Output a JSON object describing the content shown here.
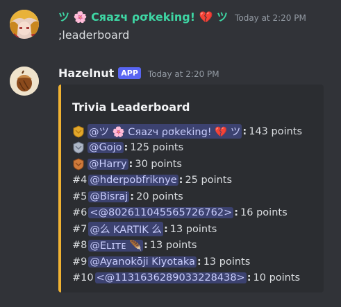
{
  "message1": {
    "author": "ツ 🌸 Cяazч ρσkeking! 💔 ツ",
    "timestamp": "Today at 2:20 PM",
    "content": ";leaderboard",
    "author_color": "#3ed6a4"
  },
  "message2": {
    "author": "Hazelnut",
    "badge": "APP",
    "timestamp": "Today at 2:20 PM"
  },
  "embed": {
    "accent_color": "#f0b232",
    "title": "Trivia Leaderboard",
    "rows": [
      {
        "rank": "",
        "medal": "gold-medal-icon",
        "user": "@ツ 🌸 Cяazч ρσkeking! 💔 ツ",
        "score": "143 points"
      },
      {
        "rank": "",
        "medal": "silver-medal-icon",
        "user": "@Gojo",
        "score": "125 points"
      },
      {
        "rank": "",
        "medal": "bronze-medal-icon",
        "user": "@Harry",
        "score": "30 points"
      },
      {
        "rank": "#4",
        "medal": "",
        "user": "@hderpobfriknye",
        "score": "25 points"
      },
      {
        "rank": "#5",
        "medal": "",
        "user": "@Bisraj",
        "score": "20 points"
      },
      {
        "rank": "#6",
        "medal": "",
        "user": "<@802611045565726762>",
        "score": "16 points"
      },
      {
        "rank": "#7",
        "medal": "",
        "user": "@么 KARTIK 么",
        "score": "13 points"
      },
      {
        "rank": "#8",
        "medal": "",
        "user": "@Eʟɪᴛᴇ 🪶",
        "score": "13 points"
      },
      {
        "rank": "#9",
        "medal": "",
        "user": "@Ayanokōji Kiyotaka",
        "score": "13 points"
      },
      {
        "rank": "#10",
        "medal": "",
        "user": "<@1131636289033228438>",
        "score": "10 points"
      }
    ]
  }
}
